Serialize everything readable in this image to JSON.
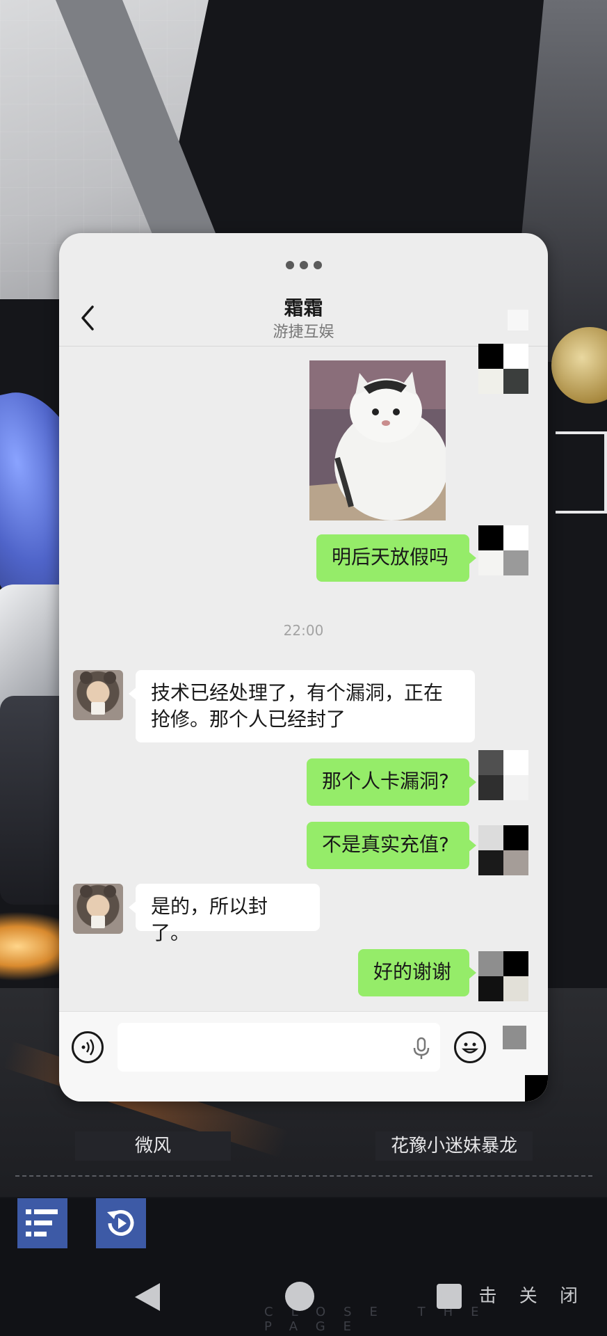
{
  "background": {
    "name_tags": [
      "微风",
      "花豫小迷妹暴龙"
    ],
    "close_hint": "点 击 关 闭",
    "close_page_faint": "CLOSE THE PAGE"
  },
  "chat": {
    "title": "霜霜",
    "subtitle": "游捷互娱",
    "timestamp": "22:00",
    "messages": [
      {
        "direction": "out",
        "type": "sticker",
        "description": "cat sticker"
      },
      {
        "direction": "out",
        "type": "text",
        "text": "明后天放假吗"
      },
      {
        "direction": "in",
        "type": "text",
        "text": "技术已经处理了，有个漏洞，正在抢修。那个人已经封了"
      },
      {
        "direction": "out",
        "type": "text",
        "text": "那个人卡漏洞?"
      },
      {
        "direction": "out",
        "type": "text",
        "text": "不是真实充值?"
      },
      {
        "direction": "in",
        "type": "text",
        "text": "是的，所以封了。"
      },
      {
        "direction": "out",
        "type": "text",
        "text": "好的谢谢"
      }
    ],
    "input": {
      "value": "",
      "placeholder": ""
    }
  },
  "colors": {
    "outgoing_bubble": "#95ec69",
    "incoming_bubble": "#ffffff",
    "chat_bg": "#ededed",
    "game_button": "#3d5aa6"
  },
  "icons": [
    "back-chevron-icon",
    "voice-icon",
    "microphone-icon",
    "emoji-icon",
    "list-icon",
    "replay-icon"
  ]
}
